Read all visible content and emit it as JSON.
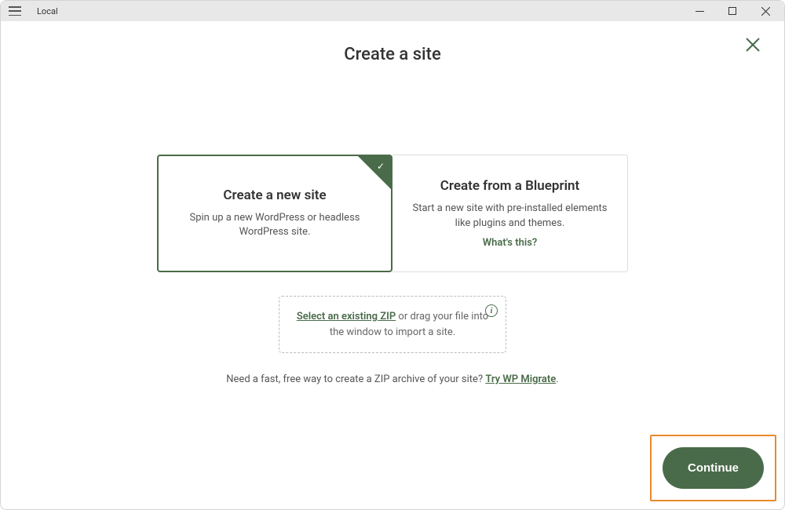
{
  "window": {
    "app_title": "Local"
  },
  "page": {
    "title": "Create a site"
  },
  "options": {
    "new_site": {
      "title": "Create a new site",
      "desc": "Spin up a new WordPress or headless WordPress site."
    },
    "blueprint": {
      "title": "Create from a Blueprint",
      "desc": "Start a new site with pre-installed elements like plugins and themes.",
      "whats_this": "What's this?"
    }
  },
  "dropzone": {
    "link": "Select an existing ZIP",
    "text_after": " or drag your file into the window to import a site."
  },
  "footer": {
    "text": "Need a fast, free way to create a ZIP archive of your site? ",
    "link": "Try WP Migrate",
    "period": "."
  },
  "buttons": {
    "continue": "Continue"
  }
}
